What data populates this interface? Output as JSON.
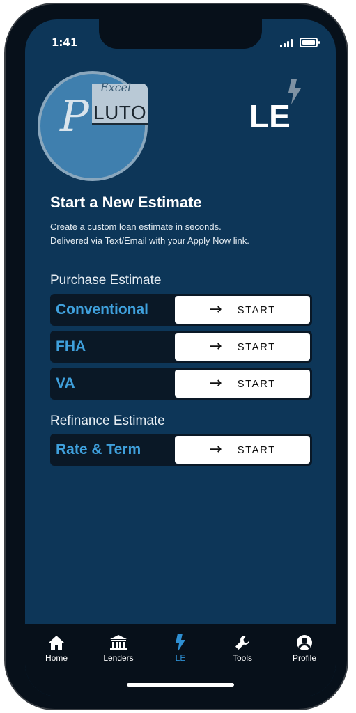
{
  "status_bar": {
    "time": "1:41"
  },
  "logo": {
    "excel": "Excel",
    "p": "P",
    "luto": "LUTO"
  },
  "brand_mark": "LE",
  "heading": "Start a New Estimate",
  "subtitle_line1": "Create a custom loan estimate in seconds.",
  "subtitle_line2": "Delivered via Text/Email with your Apply Now link.",
  "purchase": {
    "title": "Purchase Estimate",
    "items": [
      {
        "label": "Conventional",
        "action": "START"
      },
      {
        "label": "FHA",
        "action": "START"
      },
      {
        "label": "VA",
        "action": "START"
      }
    ]
  },
  "refinance": {
    "title": "Refinance Estimate",
    "items": [
      {
        "label": "Rate & Term",
        "action": "START"
      }
    ]
  },
  "tabs": [
    {
      "label": "Home",
      "icon": "home-icon"
    },
    {
      "label": "Lenders",
      "icon": "bank-icon"
    },
    {
      "label": "LE",
      "icon": "bolt-icon",
      "active": true
    },
    {
      "label": "Tools",
      "icon": "wrench-icon"
    },
    {
      "label": "Profile",
      "icon": "profile-icon"
    }
  ],
  "colors": {
    "background": "#0d3658",
    "accent": "#3fa0dc",
    "active_tab": "#2e8fd2",
    "row_bg": "#0a1826"
  }
}
